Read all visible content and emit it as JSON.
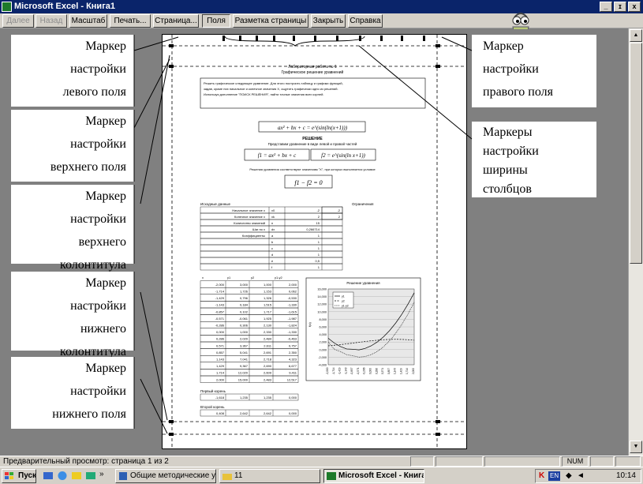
{
  "window": {
    "title": "Microsoft Excel - Книга1",
    "minimize": "_",
    "restore": "ɪ",
    "close": "x"
  },
  "toolbar": {
    "next": "Далее",
    "prev": "Назад",
    "zoom": "Масштаб",
    "print": "Печать...",
    "setup": "Страница...",
    "margins": "Поля",
    "page_break": "Разметка страницы",
    "close": "Закрыть",
    "help": "Справка"
  },
  "labels": {
    "left_margin": [
      "Маркер",
      "настройки",
      "левого поля"
    ],
    "top_margin": [
      "Маркер",
      "настройки",
      "верхнего поля"
    ],
    "header": [
      "Маркер",
      "настройки",
      "верхнего",
      "колонтитула"
    ],
    "footer": [
      "Маркер",
      "настройки",
      "нижнего",
      "колонтитула"
    ],
    "bottom_margin": [
      "Маркер",
      "настройки",
      "нижнего поля"
    ],
    "right_margin": [
      "Маркер",
      "настройки",
      "правого поля"
    ],
    "column_width": [
      "Маркеры",
      "настройки",
      "ширины",
      "столбцов"
    ]
  },
  "sheet": {
    "title1": "Лабораторная работа № 1",
    "title2": "Графическое решение уравнений",
    "task_lines": [
      "Решить графическое следующее уравнение. Для этого построить таблицу и графики функций,",
      "задав, кроме них начальное и конечное значения Х, ощутить графически одно из решений.",
      "Используя дополнение \"ПОИСК РЕШЕНИЯ\", найти точные значения всех корней."
    ],
    "eq_main": "ax² + bx + c = e^(sin(ln(x+1)))",
    "solution": "РЕШЕНИЕ",
    "represent": "Представим уравнение в виде левой и правой частей",
    "f1": "f1 = ax² + bx + c",
    "f2": "f2 = e^(sin(ln x+1))",
    "roots_text": "Решения уравнения соответствуют значениям \"Х\", при которых выполняется условие",
    "cond": "f1 − f2 = 0",
    "input_header": "Исходные данные",
    "constraints_header": "Ограничения",
    "input_rows": [
      [
        "Начальное значение x",
        "x0",
        "-2",
        "-2"
      ],
      [
        "Конечное значение x",
        "xk",
        "2",
        "2"
      ],
      [
        "Количество значений",
        "n",
        "15",
        ""
      ],
      [
        "Шаг по x",
        "dx",
        "0,266714",
        ""
      ],
      [
        "Коэффициенты",
        "a",
        "1",
        ""
      ],
      [
        "",
        "b",
        "1",
        ""
      ],
      [
        "",
        "c",
        "1",
        ""
      ],
      [
        "",
        "d",
        "1",
        ""
      ],
      [
        "",
        "e",
        "0,5",
        ""
      ],
      [
        "",
        "f",
        "1",
        ""
      ]
    ],
    "table_headers": [
      "x",
      "y1",
      "y2",
      "y1-y2"
    ],
    "table_rows": [
      [
        "-2,000",
        "3,000",
        "1,000",
        "2,000"
      ],
      [
        "-1,714",
        "1,726",
        "1,153",
        "0,062"
      ],
      [
        "-1,429",
        "0,796",
        "1,326",
        "-0,530"
      ],
      [
        "-1,143",
        "0,184",
        "1,515",
        "-1,330"
      ],
      [
        "-0,857",
        "0,102",
        "1,717",
        "-1,615"
      ],
      [
        "-0,571",
        "-0,061",
        "1,925",
        "-1,987"
      ],
      [
        "-0,286",
        "0,306",
        "2,130",
        "-1,824"
      ],
      [
        "0,000",
        "1,000",
        "2,330",
        "-1,330"
      ],
      [
        "0,286",
        "2,020",
        "2,484",
        "-0,463"
      ],
      [
        "0,571",
        "3,367",
        "2,611",
        "0,757"
      ],
      [
        "0,857",
        "5,041",
        "2,691",
        "2,350"
      ],
      [
        "1,143",
        "7,041",
        "2,718",
        "4,323"
      ],
      [
        "1,429",
        "9,367",
        "2,690",
        "6,677"
      ],
      [
        "1,714",
        "12,020",
        "2,609",
        "9,411"
      ],
      [
        "2,000",
        "15,000",
        "2,483",
        "12,517"
      ]
    ],
    "first_root_label": "Первый корень",
    "first_root": [
      "-1,618",
      "1,235",
      "1,235",
      "0,000"
    ],
    "second_root_label": "Второй корень",
    "second_root": [
      "0,408",
      "2,642",
      "2,642",
      "0,000"
    ]
  },
  "chart_data": {
    "type": "line",
    "title": "Решение уравнения",
    "ylabel": "f(x)",
    "ylim": [
      -4,
      16
    ],
    "yticks": [
      "16,000",
      "14,000",
      "12,000",
      "10,000",
      "8,000",
      "6,000",
      "4,000",
      "2,000",
      "0,000",
      "-2,000",
      "-4,000"
    ],
    "x": [
      -2.0,
      -1.714,
      -1.429,
      -1.143,
      -0.857,
      -0.571,
      -0.286,
      0.0,
      0.286,
      0.571,
      0.857,
      1.143,
      1.429,
      1.714,
      2.0
    ],
    "series": [
      {
        "name": "y1",
        "values": [
          3.0,
          1.726,
          0.796,
          0.184,
          0.102,
          -0.061,
          0.306,
          1.0,
          2.02,
          3.367,
          5.041,
          7.041,
          9.367,
          12.02,
          15.0
        ]
      },
      {
        "name": "y2",
        "values": [
          1.0,
          1.153,
          1.326,
          1.515,
          1.717,
          1.925,
          2.13,
          2.33,
          2.484,
          2.611,
          2.691,
          2.718,
          2.69,
          2.609,
          2.483
        ]
      },
      {
        "name": "y1-y2",
        "values": [
          2.0,
          0.062,
          -0.53,
          -1.33,
          -1.615,
          -1.987,
          -1.824,
          -1.33,
          -0.463,
          0.757,
          2.35,
          4.323,
          6.677,
          9.411,
          12.517
        ]
      }
    ],
    "colors": [
      "#000000",
      "#000000",
      "#000000"
    ]
  },
  "status": {
    "text": "Предварительный просмотр: страница 1 из 2",
    "num": "NUM"
  },
  "taskbar": {
    "start": "Пуск",
    "more": "»",
    "items": [
      "Общие методические у...",
      "11",
      "Microsoft Excel - Книга1"
    ],
    "tray_lang": "EN",
    "clock": "10:14"
  }
}
